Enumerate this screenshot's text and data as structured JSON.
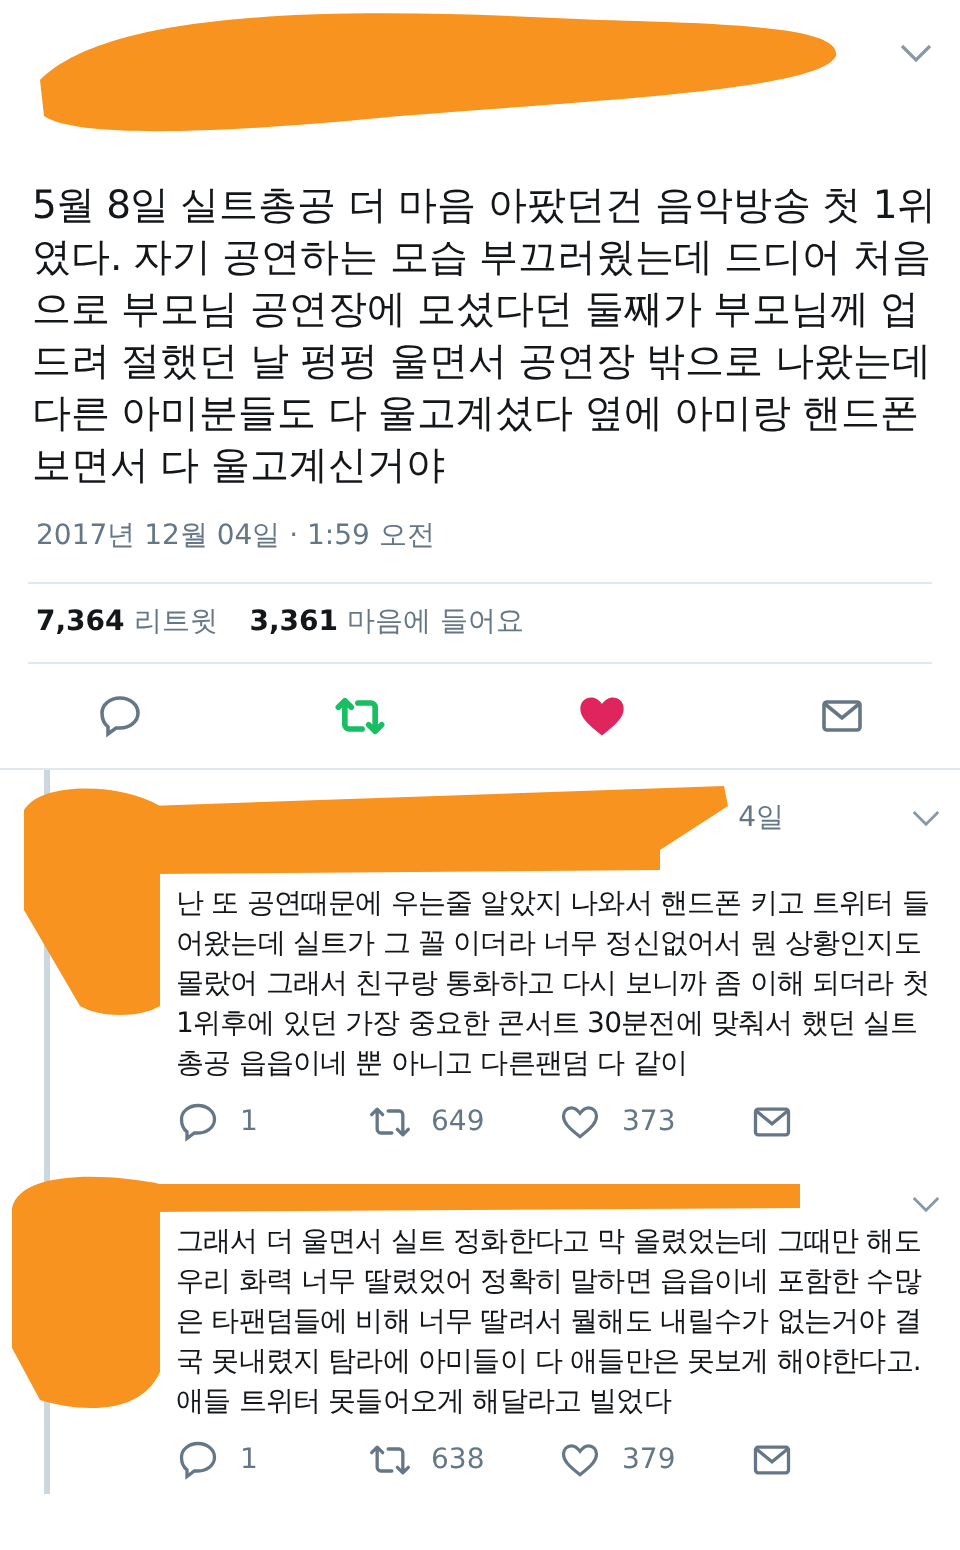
{
  "tweet": {
    "text": "5월 8일 실트총공 더 마음 아팠던건 음악방송 첫 1위였다. 자기 공연하는 모습 부끄러웠는데 드디어 처음으로 부모님 공연장에 모셨다던 둘째가 부모님께 업드려 절했던 날 펑펑 울면서 공연장 밖으로 나왔는데 다른 아미분들도 다 울고계셨다 옆에 아미랑 핸드폰 보면서 다 울고계신거야",
    "timestamp": "2017년 12월 04일 · 1:59 오전",
    "retweet_count": "7,364",
    "retweet_label": "리트윗",
    "like_count": "3,361",
    "like_label": "마음에 들어요",
    "retweeted": true,
    "liked": true
  },
  "replies": [
    {
      "time": "4일",
      "text": "난 또 공연때문에 우는줄 알았지 나와서 핸드폰 키고 트위터 들어왔는데 실트가 그 꼴 이더라 너무 정신없어서 뭔 상황인지도 몰랐어 그래서 친구랑 통화하고 다시 보니까 좀 이해 되더라 첫 1위후에 있던 가장 중요한 콘서트 30분전에 맞춰서 했던 실트총공 읍읍이네 뿐 아니고 다른팬덤 다 같이",
      "reply_count": "1",
      "retweet_count": "649",
      "like_count": "373",
      "retweeted": false,
      "liked": false
    },
    {
      "text": "그래서 더 울면서 실트 정화한다고 막 올렸었는데 그때만 해도 우리 화력 너무 딸렸었어 정확히 말하면 읍읍이네 포함한 수많은 타팬덤들에 비해 너무 딸려서 뭘해도 내릴수가 없는거야 결국 못내렸지 탐라에 아미들이 다 애들만은 못보게 해야한다고. 애들 트위터 못들어오게 해달라고 빌었다",
      "reply_count": "1",
      "retweet_count": "638",
      "like_count": "379",
      "retweeted": false,
      "liked": false
    }
  ]
}
